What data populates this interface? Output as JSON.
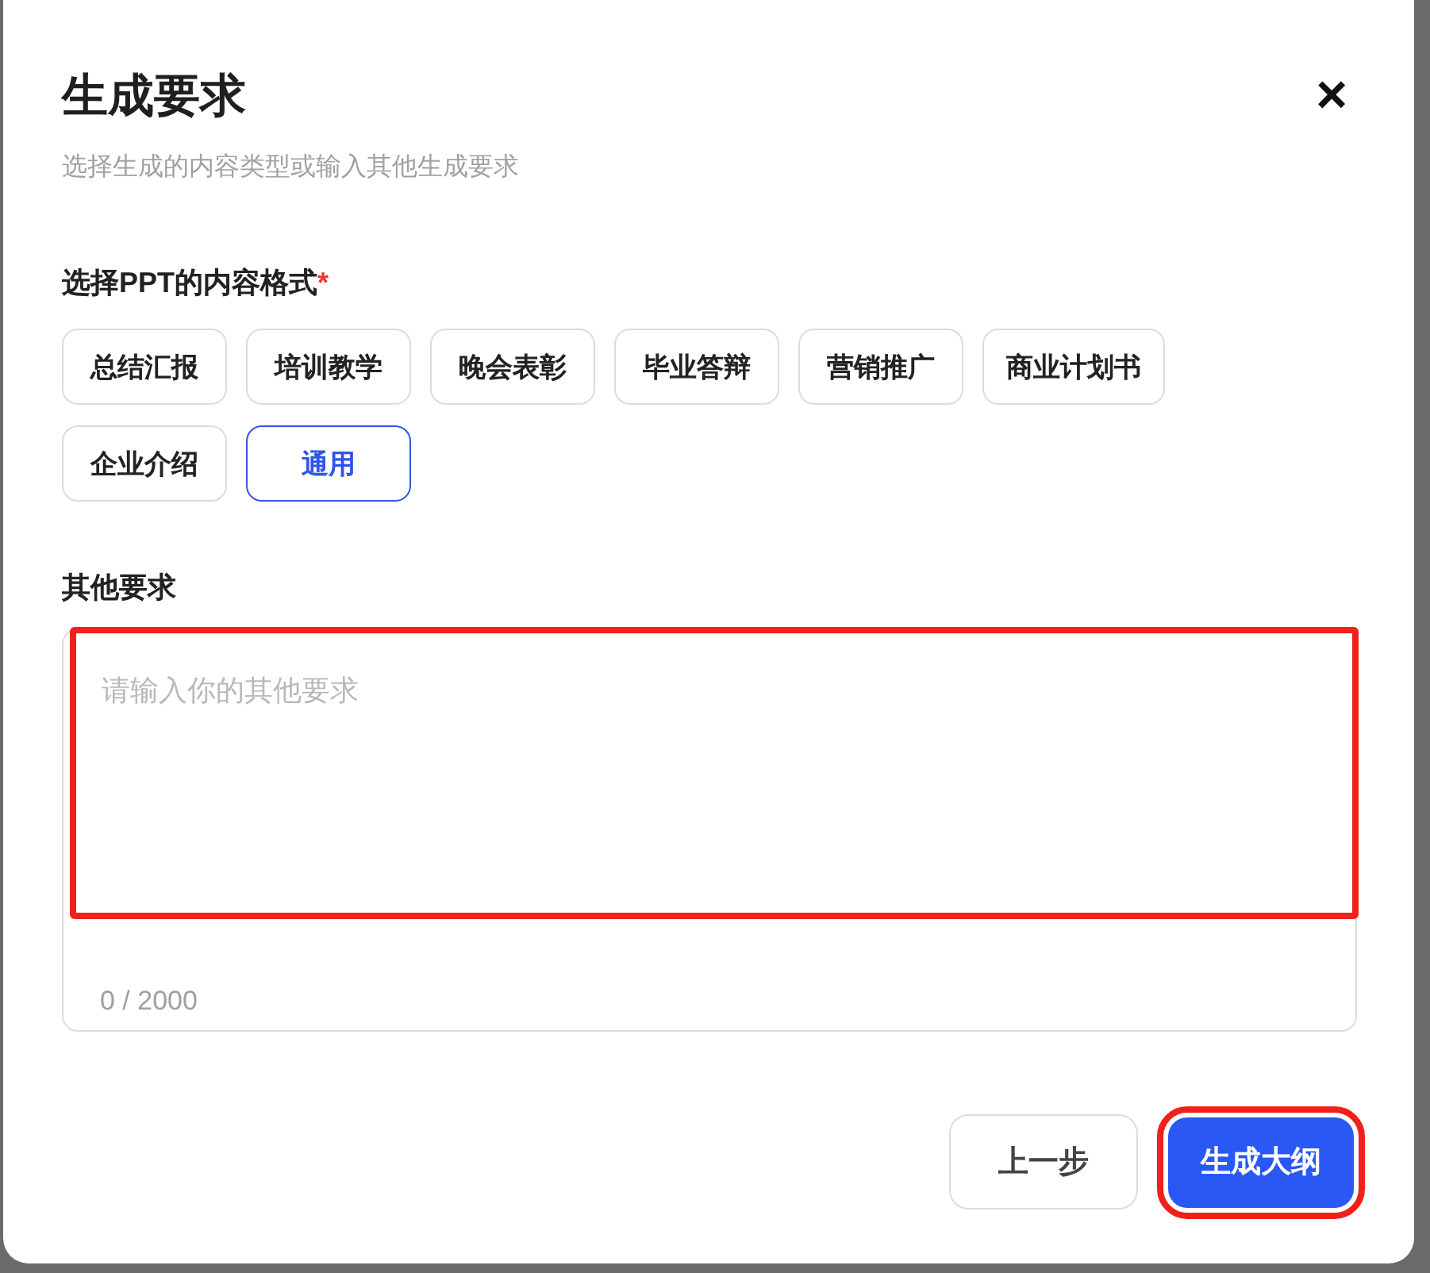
{
  "dialog": {
    "title": "生成要求",
    "subtitle": "选择生成的内容类型或输入其他生成要求",
    "close": "×"
  },
  "format": {
    "label": "选择PPT的内容格式",
    "required_mark": "*",
    "options": [
      {
        "label": "总结汇报",
        "selected": false
      },
      {
        "label": "培训教学",
        "selected": false
      },
      {
        "label": "晚会表彰",
        "selected": false
      },
      {
        "label": "毕业答辩",
        "selected": false
      },
      {
        "label": "营销推广",
        "selected": false
      },
      {
        "label": "商业计划书",
        "selected": false
      },
      {
        "label": "企业介绍",
        "selected": false
      },
      {
        "label": "通用",
        "selected": true
      }
    ]
  },
  "other": {
    "label": "其他要求",
    "placeholder": "请输入你的其他要求",
    "counter": "0 / 2000",
    "highlighted": true
  },
  "buttons": [
    {
      "label": "上一步",
      "kind": "secondary",
      "highlighted": false
    },
    {
      "label": "生成大纲",
      "kind": "primary",
      "highlighted": true
    }
  ]
}
